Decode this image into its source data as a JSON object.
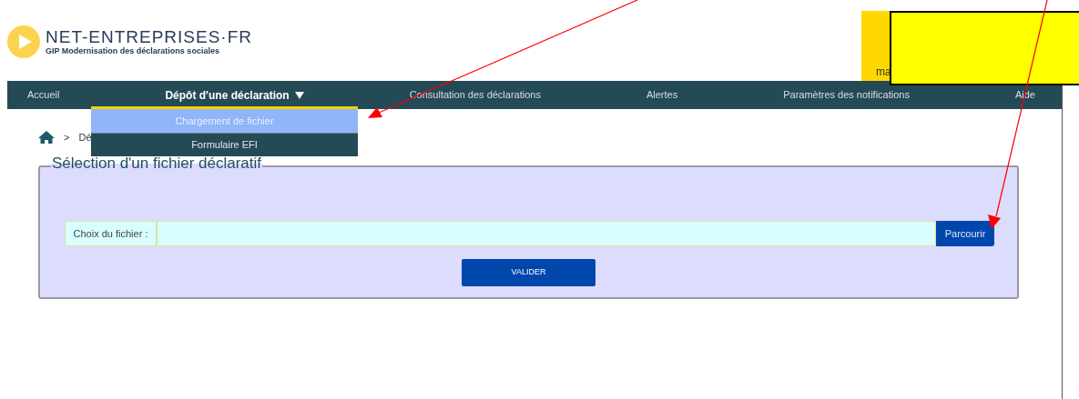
{
  "header": {
    "logo": {
      "name": "NET-ENTREPRISES·FR",
      "tagline": "GIP Modernisation des déclarations sociales"
    },
    "account_box": {
      "text": "ma"
    }
  },
  "nav": {
    "items": [
      {
        "label": "Accueil",
        "selected": false
      },
      {
        "label": "Dépôt d'une déclaration",
        "selected": true,
        "expanded": true
      },
      {
        "label": "Consultation des déclarations",
        "selected": false
      },
      {
        "label": "Alertes",
        "selected": false
      },
      {
        "label": "Paramètres des notifications",
        "selected": false
      },
      {
        "label": "Aide",
        "selected": false
      }
    ],
    "dropdown": [
      {
        "label": "Chargement de fichier",
        "selected": true
      },
      {
        "label": "Formulaire EFI",
        "selected": false
      }
    ]
  },
  "breadcrumb": {
    "separator": ">",
    "text": "Dé"
  },
  "form": {
    "legend": "Sélection d'un fichier déclaratif",
    "file_label": "Choix du fichier :",
    "browse_button": "Parcourir",
    "submit_button": "VALIDER"
  }
}
